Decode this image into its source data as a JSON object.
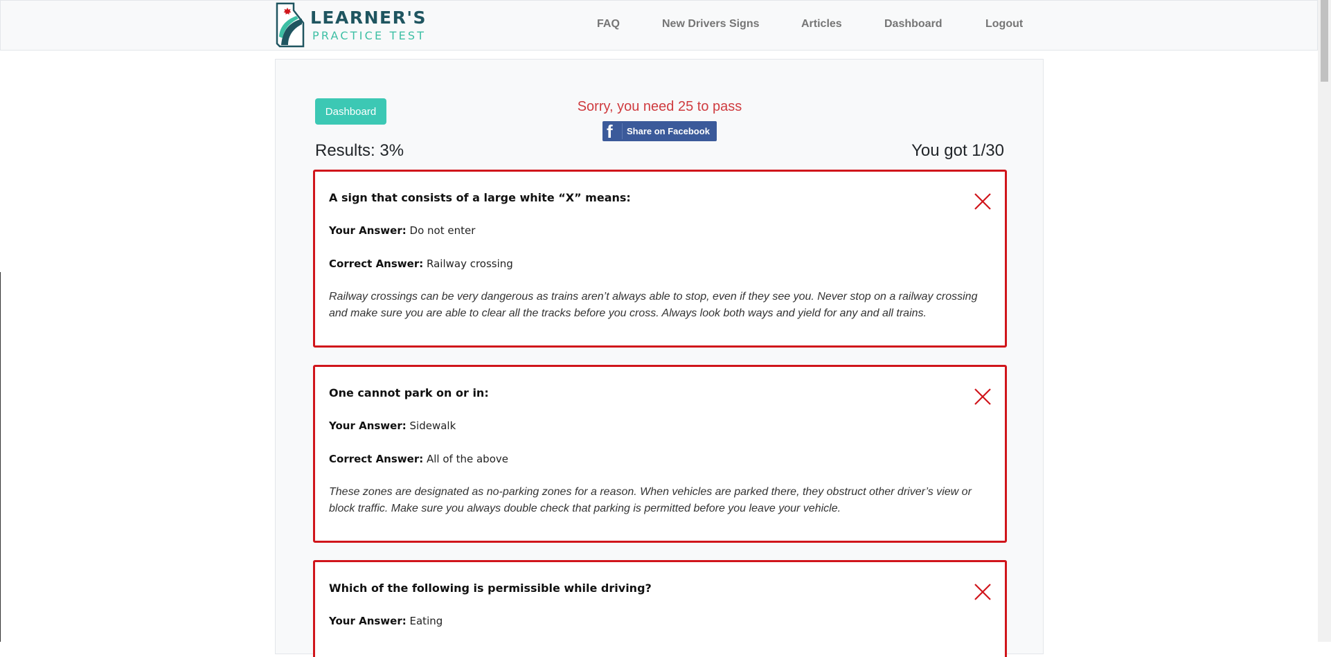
{
  "brand": {
    "line1": "LEARNER'S",
    "line2": "PRACTICE TEST"
  },
  "nav": [
    {
      "label": "FAQ"
    },
    {
      "label": "New Drivers Signs"
    },
    {
      "label": "Articles"
    },
    {
      "label": "Dashboard"
    },
    {
      "label": "Logout"
    }
  ],
  "results_page": {
    "dashboard_button": "Dashboard",
    "fail_message": "Sorry, you need 25 to pass",
    "share_button": "Share on Facebook",
    "results_text": "Results: 3%",
    "score_text": "You got 1/30"
  },
  "labels": {
    "your_answer": "Your Answer:",
    "correct_answer": "Correct Answer:"
  },
  "questions": [
    {
      "question": "A sign that consists of a large white “X” means:",
      "your_answer": "Do not enter",
      "correct_answer": "Railway crossing",
      "explanation": "Railway crossings can be very dangerous as trains aren’t always able to stop, even if they see you. Never stop on a railway crossing and make sure you are able to clear all the tracks before you cross. Always look both ways and yield for any and all trains."
    },
    {
      "question": "One cannot park on or in:",
      "your_answer": "Sidewalk",
      "correct_answer": "All of the above",
      "explanation": "These zones are designated as no-parking zones for a reason. When vehicles are parked there, they obstruct other driver’s view or block traffic. Make sure you always double check that parking is permitted before you leave your vehicle."
    },
    {
      "question": "Which of the following is permissible while driving?",
      "your_answer": "Eating"
    }
  ],
  "colors": {
    "accent": "#3cc8b4",
    "error": "#d0151b",
    "fail_text": "#cf3b3f",
    "facebook": "#3b5a9a",
    "brand_dark": "#1f5560"
  },
  "icons": {
    "logo": "province-road-logo",
    "facebook": "facebook-f-icon",
    "wrong": "x-mark-icon"
  }
}
